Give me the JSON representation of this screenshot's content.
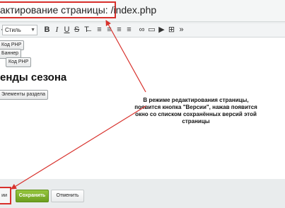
{
  "titlebar": {
    "title": "актирование страницы: /index.php"
  },
  "toolbar": {
    "style_select": "Стиль",
    "buttons": [
      {
        "glyph": "B"
      },
      {
        "glyph": "I"
      },
      {
        "glyph": "U"
      },
      {
        "glyph": "S"
      },
      {
        "glyph": "T̶"
      },
      {
        "glyph": "≡"
      },
      {
        "glyph": "≡"
      },
      {
        "glyph": "≡"
      },
      {
        "glyph": "≡"
      },
      {
        "glyph": "∞"
      },
      {
        "glyph": "▭"
      },
      {
        "glyph": "▶"
      },
      {
        "glyph": "⊞"
      },
      {
        "glyph": "»"
      }
    ]
  },
  "editor": {
    "php_button_1": "Код PHP",
    "banner_button": "Баннер",
    "php_button_2": "Код PHP",
    "heading": "енды сезона",
    "section_elements_button": "Элементы раздела"
  },
  "footer": {
    "versions_button": "ии",
    "save_button": "Сохранить",
    "cancel_button": "Отменить"
  },
  "annotation": {
    "lines": [
      "В режиме редактирования страницы,",
      "появится кнопка \"Версии\", нажав появится",
      "окно со списком сохранённых версий этой",
      "страницы"
    ]
  },
  "colors": {
    "highlight": "#d8312c",
    "save_green": "#7aad28"
  }
}
